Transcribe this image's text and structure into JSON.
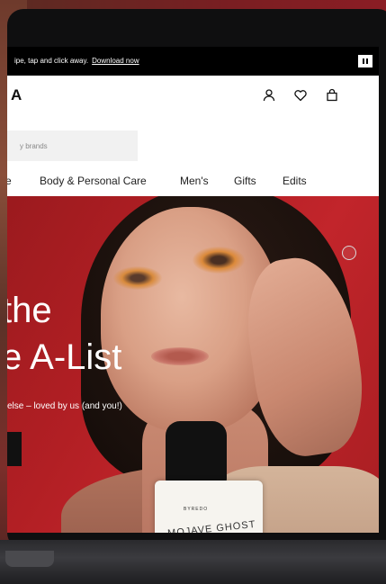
{
  "promo": {
    "text": "ipe, tap and click away.",
    "link": "Download now"
  },
  "header": {
    "logo": "A",
    "icons": [
      "user-icon",
      "heart-icon",
      "bag-icon"
    ]
  },
  "search": {
    "placeholder": "y brands"
  },
  "nav": {
    "items": [
      {
        "label": "e"
      },
      {
        "label": "Body & Personal Care"
      },
      {
        "label": "Men's"
      },
      {
        "label": "Gifts"
      },
      {
        "label": "Edits"
      }
    ]
  },
  "hero": {
    "headline_1": "the",
    "headline_2": "e A-List",
    "subtitle": "else – loved by us (and you!)",
    "product_brand": "BYREDO",
    "product_name": "MOJAVE GHOST"
  },
  "colors": {
    "hero_bg": "#b21f24",
    "promo_bg": "#000000"
  }
}
